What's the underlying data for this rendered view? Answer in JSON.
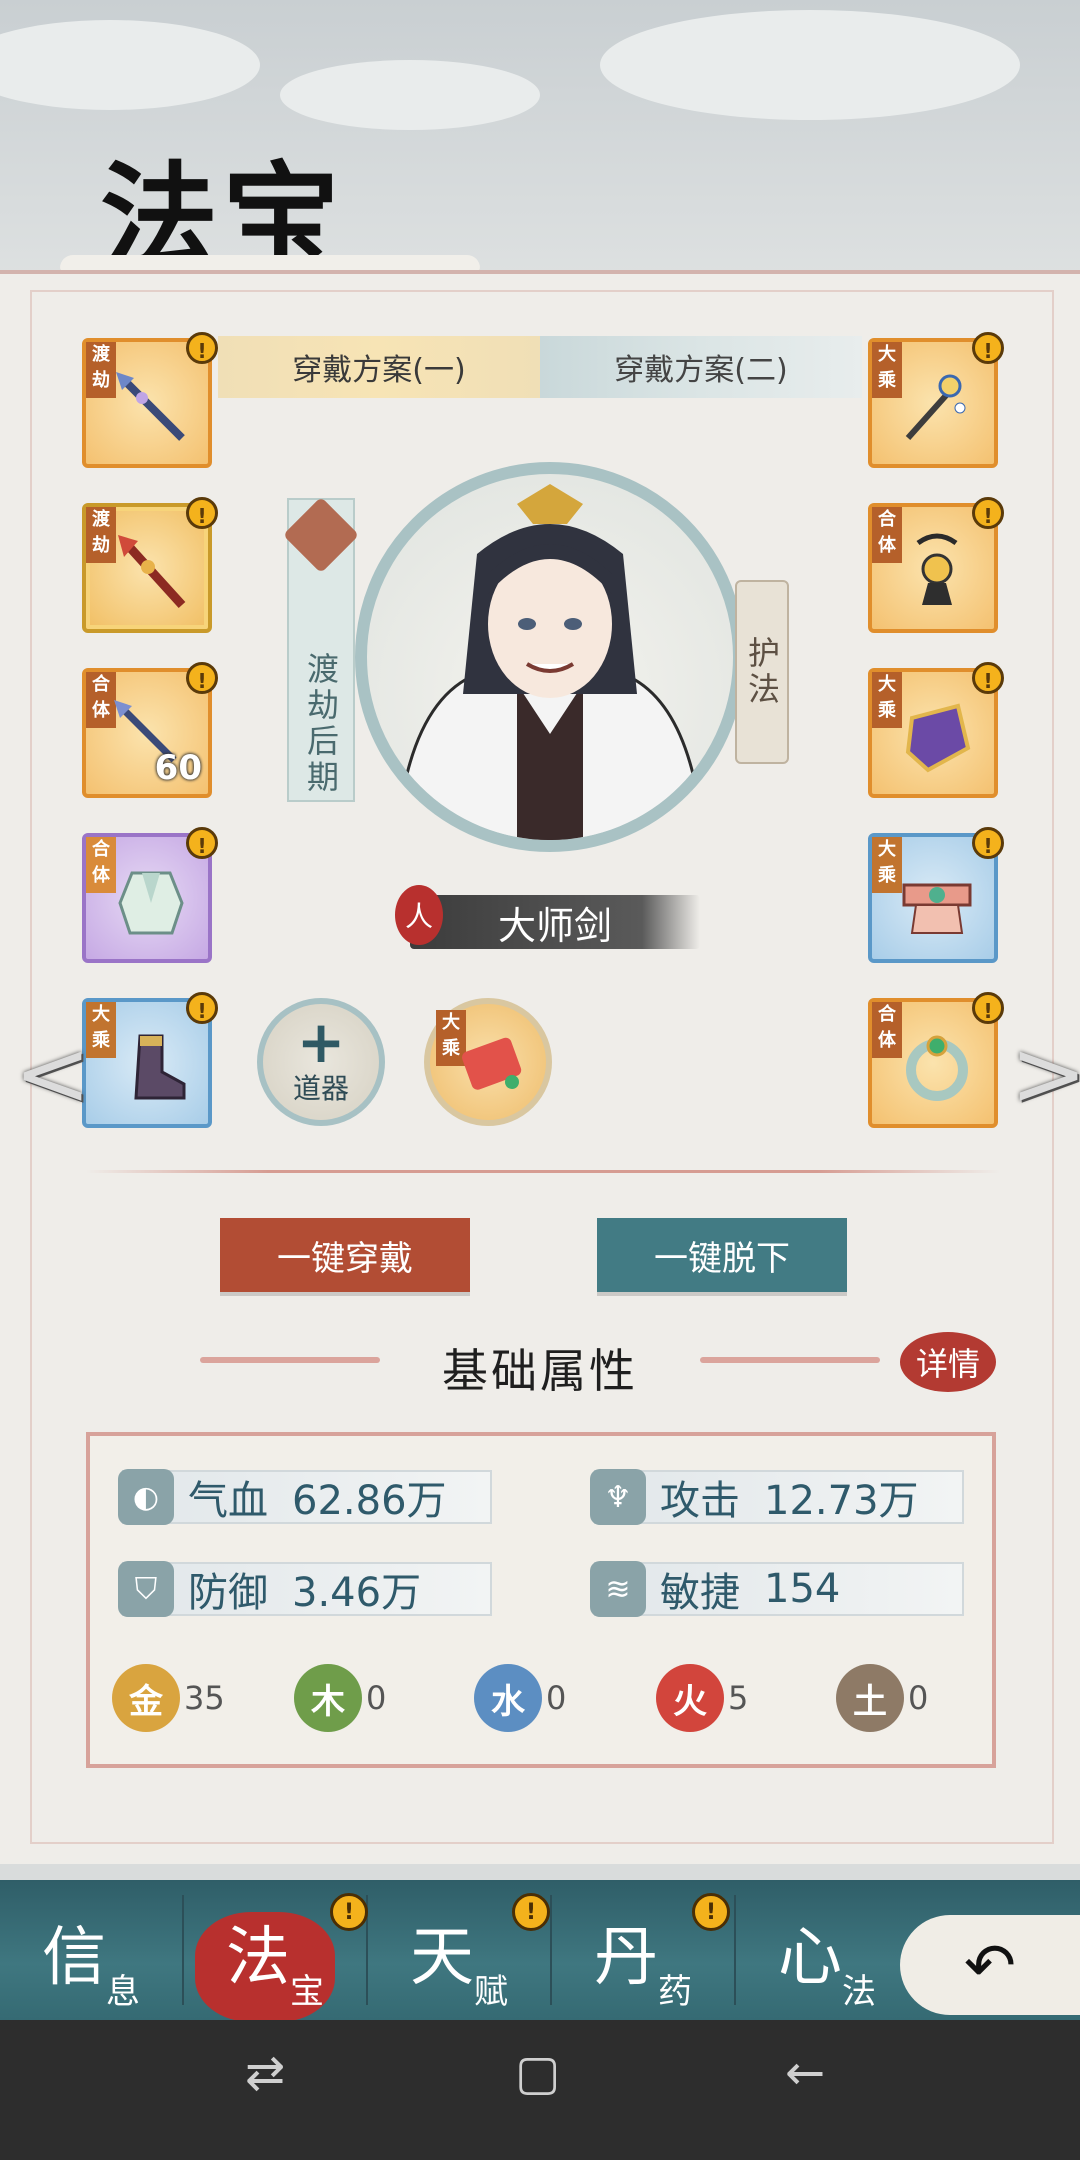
{
  "header": {
    "title": "法宝"
  },
  "tabs": [
    {
      "label": "穿戴方案(一)",
      "active": true
    },
    {
      "label": "穿戴方案(二)",
      "active": false
    }
  ],
  "left_slots": [
    {
      "tag": "渡劫",
      "style": "orange",
      "icon": "spear-icon",
      "count": ""
    },
    {
      "tag": "渡劫",
      "style": "gold",
      "icon": "halberd-icon",
      "count": ""
    },
    {
      "tag": "合体",
      "style": "orange",
      "icon": "spear-icon",
      "count": "60"
    },
    {
      "tag": "合体",
      "style": "purple",
      "icon": "robe-icon",
      "count": ""
    },
    {
      "tag": "大乘",
      "style": "blue",
      "icon": "boot-icon",
      "count": ""
    }
  ],
  "right_slots": [
    {
      "tag": "大乘",
      "style": "orange",
      "icon": "hairpin-icon"
    },
    {
      "tag": "合体",
      "style": "orange",
      "icon": "pendant-icon"
    },
    {
      "tag": "大乘",
      "style": "orange",
      "icon": "armor-icon"
    },
    {
      "tag": "大乘",
      "style": "blue",
      "icon": "belt-icon"
    },
    {
      "tag": "合体",
      "style": "orange",
      "icon": "ring-icon"
    }
  ],
  "character": {
    "realm": "渡劫后期",
    "guard": "护法",
    "mark": "人",
    "name": "大师剑"
  },
  "tool_slot": {
    "symbol": "+",
    "label": "道器"
  },
  "talisman": {
    "tag": "大乘",
    "icon": "talisman-icon"
  },
  "actions": {
    "wear_all": "一键穿戴",
    "remove_all": "一键脱下"
  },
  "attributes": {
    "title": "基础属性",
    "detail_label": "详情",
    "stats": [
      {
        "name": "气血",
        "value": "62.86万",
        "icon": "blood-drop-icon"
      },
      {
        "name": "攻击",
        "value": "12.73万",
        "icon": "sword-hilt-icon"
      },
      {
        "name": "防御",
        "value": "3.46万",
        "icon": "shield-icon"
      },
      {
        "name": "敏捷",
        "value": "154",
        "icon": "wing-icon"
      }
    ],
    "elements": [
      {
        "glyph": "金",
        "value": "35",
        "color": "#d9a43f"
      },
      {
        "glyph": "木",
        "value": "0",
        "color": "#6f9d4a"
      },
      {
        "glyph": "水",
        "value": "0",
        "color": "#5c8ec2"
      },
      {
        "glyph": "火",
        "value": "5",
        "color": "#d2453c"
      },
      {
        "glyph": "土",
        "value": "0",
        "color": "#8e7a66"
      }
    ]
  },
  "nav": [
    {
      "main": "信",
      "sub": "息",
      "alert": false,
      "active": false
    },
    {
      "main": "法",
      "sub": "宝",
      "alert": true,
      "active": true
    },
    {
      "main": "天",
      "sub": "赋",
      "alert": true,
      "active": false
    },
    {
      "main": "丹",
      "sub": "药",
      "alert": true,
      "active": false
    },
    {
      "main": "心",
      "sub": "法",
      "alert": false,
      "active": false
    }
  ],
  "alert_glyph": "!",
  "back_icon": "return-arrow-icon",
  "system_nav": {
    "recent": "⇄",
    "home": "▢",
    "back": "←"
  }
}
